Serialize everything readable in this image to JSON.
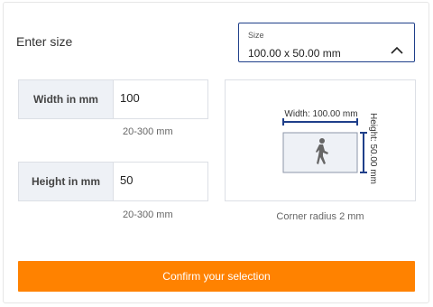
{
  "header": {
    "title": "Enter size"
  },
  "size_select": {
    "label": "Size",
    "value": "100.00 x 50.00 mm",
    "icon": "chevron-up-icon"
  },
  "width": {
    "label": "Width in mm",
    "value": "100",
    "hint": "20-300 mm"
  },
  "height": {
    "label": "Height in mm",
    "value": "50",
    "hint": "20-300 mm"
  },
  "preview": {
    "width_label": "Width: 100.00 mm",
    "height_label": "Height: 50.00 mm",
    "icon": "pedestrian-icon",
    "accent": "#1f3f8a",
    "corner_note": "Corner radius 2 mm"
  },
  "actions": {
    "confirm_label": "Confirm your selection",
    "confirm_color": "#ff8200"
  }
}
